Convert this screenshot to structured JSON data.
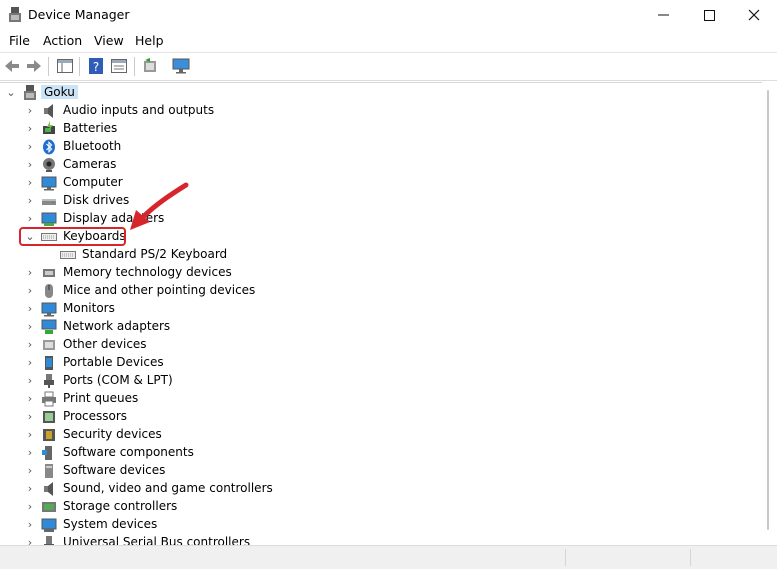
{
  "window": {
    "title": "Device Manager"
  },
  "menu": [
    "File",
    "Action",
    "View",
    "Help"
  ],
  "tree": {
    "root": "Goku",
    "items": [
      {
        "label": "Audio inputs and outputs",
        "icon": "speaker-icon"
      },
      {
        "label": "Batteries",
        "icon": "battery-icon"
      },
      {
        "label": "Bluetooth",
        "icon": "bluetooth-icon"
      },
      {
        "label": "Cameras",
        "icon": "camera-icon"
      },
      {
        "label": "Computer",
        "icon": "computer-icon"
      },
      {
        "label": "Disk drives",
        "icon": "disk-drive-icon"
      },
      {
        "label": "Display adapters",
        "icon": "display-adapter-icon"
      },
      {
        "label": "Keyboards",
        "icon": "keyboard-icon",
        "expanded": true,
        "children": [
          "Standard PS/2 Keyboard"
        ]
      },
      {
        "label": "Memory technology devices",
        "icon": "memory-icon"
      },
      {
        "label": "Mice and other pointing devices",
        "icon": "mouse-icon"
      },
      {
        "label": "Monitors",
        "icon": "monitor-icon"
      },
      {
        "label": "Network adapters",
        "icon": "network-adapter-icon"
      },
      {
        "label": "Other devices",
        "icon": "other-device-icon"
      },
      {
        "label": "Portable Devices",
        "icon": "portable-device-icon"
      },
      {
        "label": "Ports (COM & LPT)",
        "icon": "port-icon"
      },
      {
        "label": "Print queues",
        "icon": "printer-icon"
      },
      {
        "label": "Processors",
        "icon": "processor-icon"
      },
      {
        "label": "Security devices",
        "icon": "security-device-icon"
      },
      {
        "label": "Software components",
        "icon": "software-component-icon"
      },
      {
        "label": "Software devices",
        "icon": "software-device-icon"
      },
      {
        "label": "Sound, video and game controllers",
        "icon": "sound-icon"
      },
      {
        "label": "Storage controllers",
        "icon": "storage-icon"
      },
      {
        "label": "System devices",
        "icon": "system-device-icon"
      },
      {
        "label": "Universal Serial Bus controllers",
        "icon": "usb-icon"
      }
    ]
  },
  "annotation_color": "#d6262b",
  "selection_color": "#cce4f7"
}
